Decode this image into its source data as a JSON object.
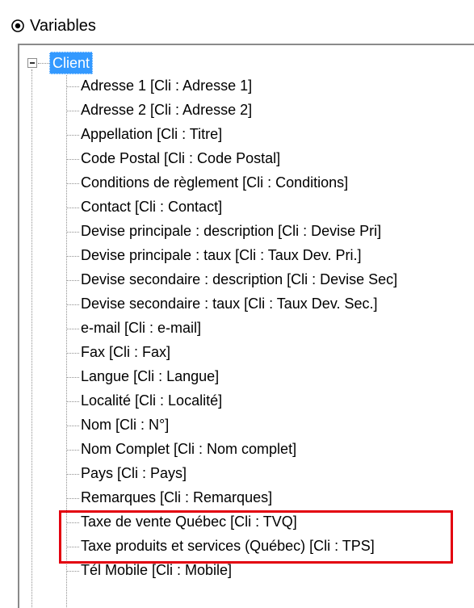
{
  "window": {
    "title": "Variables",
    "title_icon": "radio-circle-icon"
  },
  "tree": {
    "root": {
      "label": "Client",
      "expanded": true,
      "selected": true,
      "expander_icon": "collapse-minus-icon"
    },
    "items": [
      {
        "label": "Adresse 1 [Cli : Adresse 1]"
      },
      {
        "label": "Adresse 2 [Cli : Adresse 2]"
      },
      {
        "label": "Appellation [Cli : Titre]"
      },
      {
        "label": "Code Postal [Cli : Code Postal]"
      },
      {
        "label": "Conditions de règlement [Cli : Conditions]"
      },
      {
        "label": "Contact [Cli : Contact]"
      },
      {
        "label": "Devise principale : description [Cli : Devise Pri]"
      },
      {
        "label": "Devise principale : taux [Cli : Taux Dev. Pri.]"
      },
      {
        "label": "Devise secondaire : description [Cli : Devise Sec]"
      },
      {
        "label": "Devise secondaire : taux [Cli : Taux Dev. Sec.]"
      },
      {
        "label": "e-mail [Cli : e-mail]"
      },
      {
        "label": "Fax [Cli : Fax]"
      },
      {
        "label": "Langue [Cli : Langue]"
      },
      {
        "label": "Localité [Cli : Localité]"
      },
      {
        "label": "Nom [Cli : N°]"
      },
      {
        "label": "Nom Complet [Cli : Nom complet]"
      },
      {
        "label": "Pays [Cli : Pays]"
      },
      {
        "label": "Remarques [Cli : Remarques]"
      },
      {
        "label": "Taxe de vente Québec [Cli : TVQ]"
      },
      {
        "label": "Taxe produits et services (Québec) [Cli : TPS]"
      },
      {
        "label": "Tél Mobile [Cli : Mobile]"
      }
    ]
  },
  "annotation": {
    "color": "#e3000f",
    "highlighted_items": [
      "Taxe de vente Québec [Cli : TVQ]",
      "Taxe produits et services (Québec) [Cli : TPS]"
    ]
  },
  "colors": {
    "selection_bg": "#3399ff",
    "selection_text": "#ffffff",
    "tree_lines": "#8f8f8f"
  }
}
